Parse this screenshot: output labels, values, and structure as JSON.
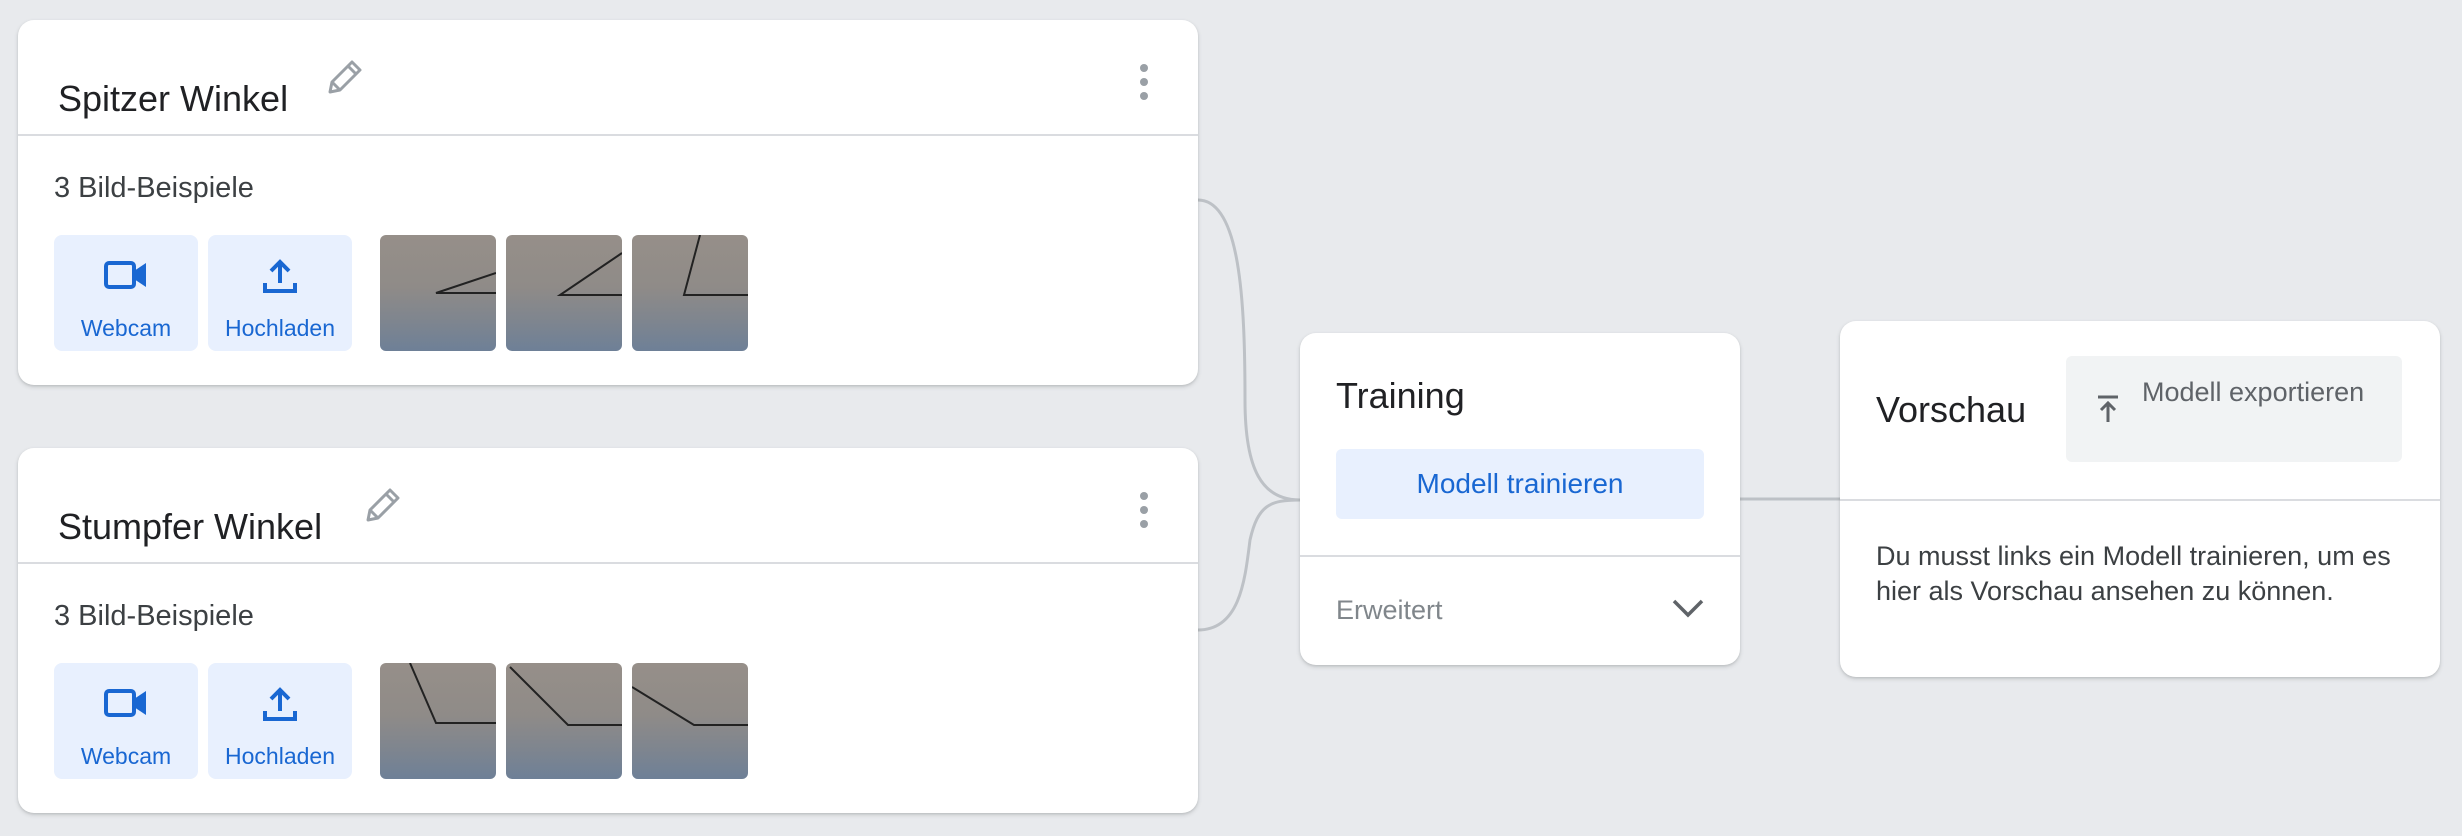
{
  "classes": [
    {
      "title": "Spitzer Winkel",
      "count_label": "3 Bild-Beispiele",
      "webcam_label": "Webcam",
      "upload_label": "Hochladen"
    },
    {
      "title": "Stumpfer Winkel",
      "count_label": "3 Bild-Beispiele",
      "webcam_label": "Webcam",
      "upload_label": "Hochladen"
    }
  ],
  "training": {
    "title": "Training",
    "train_button": "Modell trainieren",
    "advanced_label": "Erweitert"
  },
  "preview": {
    "title": "Vorschau",
    "export_button": "Modell exportieren",
    "message": "Du musst links ein Modell trainieren, um es hier als Vorschau ansehen zu können."
  },
  "icons": {
    "edit": "pencil-icon",
    "menu": "more-vert-icon",
    "webcam": "videocam-icon",
    "upload": "upload-icon",
    "export": "export-icon",
    "expand": "chevron-down-icon"
  },
  "colors": {
    "accent": "#1967d2",
    "button_bg": "#e8f0fe",
    "background": "#e8eaed",
    "connector": "#bdc1c6"
  }
}
